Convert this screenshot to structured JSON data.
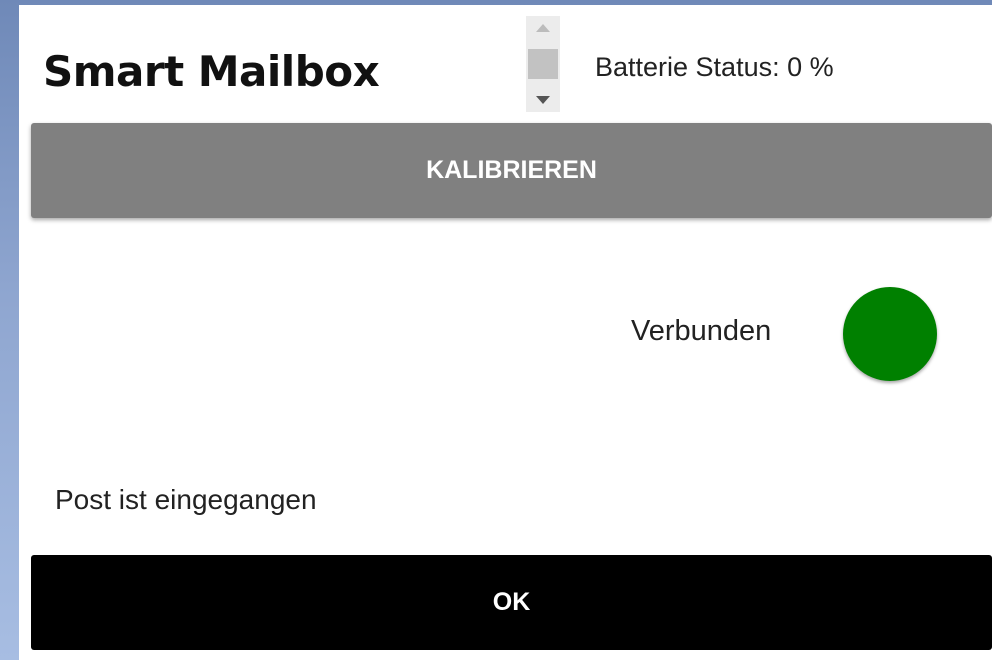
{
  "app": {
    "title": "Smart Mailbox"
  },
  "battery": {
    "label": "Batterie Status: 0 %",
    "percent": 0
  },
  "buttons": {
    "calibrate_label": "KALIBRIEREN",
    "ok_label": "OK"
  },
  "connection": {
    "label": "Verbunden",
    "indicator_color": "#008000"
  },
  "notification": {
    "message": "Post ist eingegangen"
  },
  "colors": {
    "calibrate_button": "#808080",
    "ok_button": "#000000",
    "background": "#ffffff"
  },
  "icons": {
    "spin_up": "spin-up-arrow-icon",
    "spin_down": "spin-down-arrow-icon",
    "status": "status-dot-icon"
  }
}
